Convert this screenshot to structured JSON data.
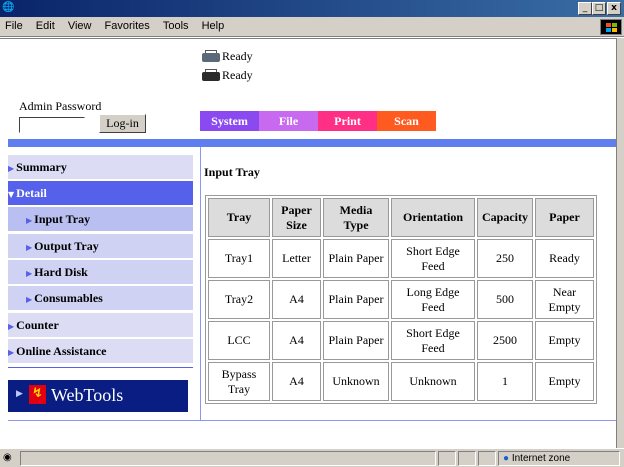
{
  "window": {
    "app_icon": "ie-icon",
    "buttons": [
      "minimize-button",
      "maximize-button",
      "close-button"
    ]
  },
  "menubar": {
    "items": [
      "File",
      "Edit",
      "View",
      "Favorites",
      "Tools",
      "Help"
    ]
  },
  "status_lines": [
    {
      "icon": "printer-icon",
      "text": "Ready"
    },
    {
      "icon": "scanner-printer-icon",
      "text": "Ready"
    }
  ],
  "admin": {
    "label": "Admin Password",
    "password_value": "",
    "login_label": "Log-in"
  },
  "tabs": [
    {
      "label": "System",
      "color": "#8a4af0"
    },
    {
      "label": "File",
      "color": "#c76af0"
    },
    {
      "label": "Print",
      "color": "#ff2f86"
    },
    {
      "label": "Scan",
      "color": "#ff5a1f"
    }
  ],
  "sidebar": {
    "items": [
      {
        "label": "Summary",
        "level": 0
      },
      {
        "label": "Detail",
        "level": 0,
        "expanded": true
      },
      {
        "label": "Input Tray",
        "level": 1,
        "selected": true
      },
      {
        "label": "Output Tray",
        "level": 1
      },
      {
        "label": "Hard Disk",
        "level": 1
      },
      {
        "label": "Consumables",
        "level": 1
      },
      {
        "label": "Counter",
        "level": 0
      },
      {
        "label": "Online Assistance",
        "level": 0
      }
    ],
    "webtools_label": "WebTools",
    "webtools_logo_text": "fuzzy"
  },
  "main": {
    "title": "Input Tray",
    "columns": [
      "Tray",
      "Paper Size",
      "Media Type",
      "Orientation",
      "Capacity",
      "Paper"
    ],
    "rows": [
      [
        "Tray1",
        "Letter",
        "Plain Paper",
        "Short Edge Feed",
        "250",
        "Ready"
      ],
      [
        "Tray2",
        "A4",
        "Plain Paper",
        "Long Edge Feed",
        "500",
        "Near Empty"
      ],
      [
        "LCC",
        "A4",
        "Plain Paper",
        "Short Edge Feed",
        "2500",
        "Empty"
      ],
      [
        "Bypass Tray",
        "A4",
        "Unknown",
        "Unknown",
        "1",
        "Empty"
      ]
    ]
  },
  "statusbar": {
    "zone": "Internet zone"
  },
  "colors": {
    "accent": "#5561ea",
    "band": "#5f7ff0",
    "webtools_bg": "#0a1d82"
  }
}
